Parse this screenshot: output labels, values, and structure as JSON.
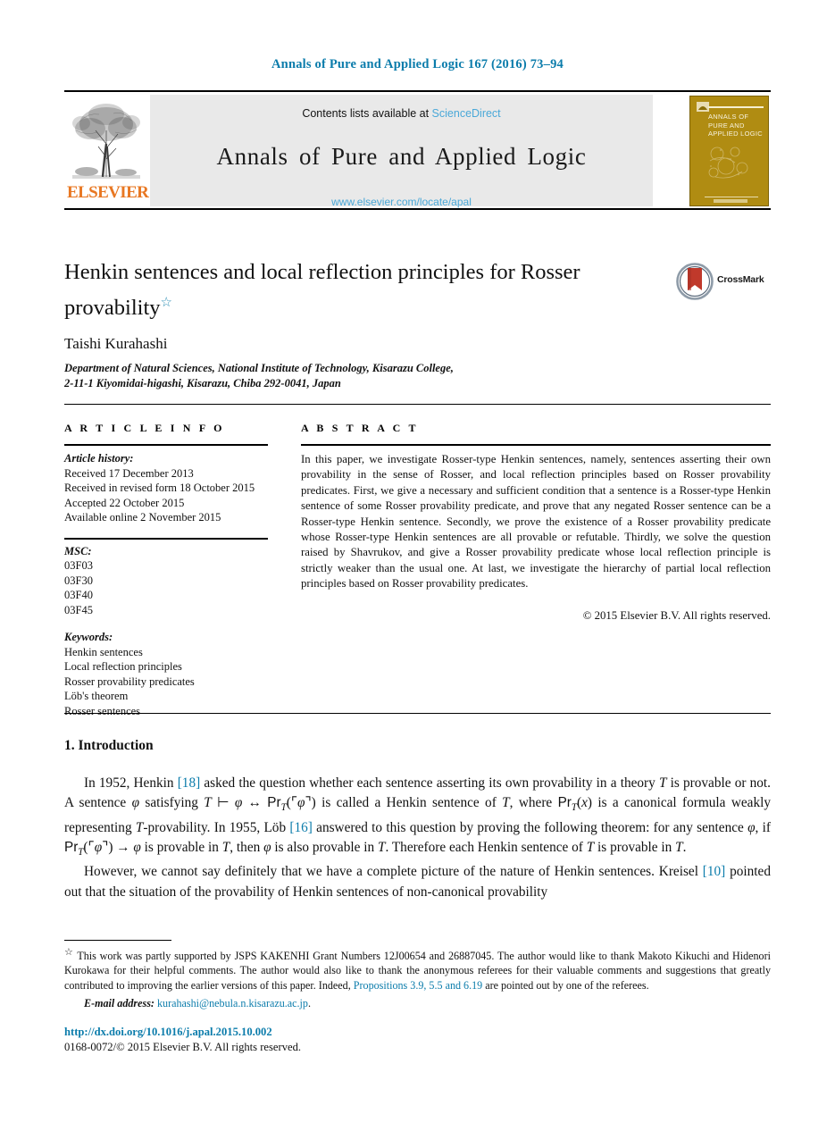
{
  "running_head": "Annals of Pure and Applied Logic 167 (2016) 73–94",
  "masthead": {
    "publisher_wordmark": "ELSEVIER",
    "contents_prefix": "Contents lists available at ",
    "contents_link": "ScienceDirect",
    "journal_name": "Annals of Pure and Applied Logic",
    "journal_url": "www.elsevier.com/locate/apal",
    "cover_title": "ANNALS OF PURE AND APPLIED LOGIC"
  },
  "crossmark": {
    "label": "CrossMark"
  },
  "title": {
    "text": "Henkin sentences and local reflection principles for Rosser provability",
    "footnote_marker": "☆"
  },
  "author": "Taishi Kurahashi",
  "affiliation_line1": "Department of Natural Sciences, National Institute of Technology, Kisarazu College,",
  "affiliation_line2": "2-11-1 Kiyomidai-higashi, Kisarazu, Chiba 292-0041, Japan",
  "info": {
    "heading": "A R T I C L E   I N F O",
    "history_label": "Article history:",
    "history": [
      "Received 17 December 2013",
      "Received in revised form 18 October 2015",
      "Accepted 22 October 2015",
      "Available online 2 November 2015"
    ],
    "msc_label": "MSC:",
    "msc": [
      "03F03",
      "03F30",
      "03F40",
      "03F45"
    ],
    "keywords_label": "Keywords:",
    "keywords": [
      "Henkin sentences",
      "Local reflection principles",
      "Rosser provability predicates",
      "Löb's theorem",
      "Rosser sentences"
    ]
  },
  "abstract": {
    "heading": "A B S T R A C T",
    "text": "In this paper, we investigate Rosser-type Henkin sentences, namely, sentences asserting their own provability in the sense of Rosser, and local reflection principles based on Rosser provability predicates. First, we give a necessary and sufficient condition that a sentence is a Rosser-type Henkin sentence of some Rosser provability predicate, and prove that any negated Rosser sentence can be a Rosser-type Henkin sentence. Secondly, we prove the existence of a Rosser provability predicate whose Rosser-type Henkin sentences are all provable or refutable. Thirdly, we solve the question raised by Shavrukov, and give a Rosser provability predicate whose local reflection principle is strictly weaker than the usual one. At last, we investigate the hierarchy of partial local reflection principles based on Rosser provability predicates.",
    "copyright": "© 2015 Elsevier B.V. All rights reserved."
  },
  "body": {
    "section_title": "1. Introduction",
    "para1_a": "In 1952, Henkin ",
    "para1_ref1": "[18]",
    "para1_b": " asked the question whether each sentence asserting its own provability in a theory ",
    "para1_c": " is provable or not. A sentence ",
    "para1_d": " satisfying ",
    "para1_e": " is called a Henkin sentence of ",
    "para1_f": ", where ",
    "para1_g": " is a canonical formula weakly representing ",
    "para1_h": "-provability. In 1955, Löb ",
    "para1_ref2": "[16]",
    "para1_i": " answered to this question by proving the following theorem: for any sentence ",
    "para1_j": ", if ",
    "para1_k": " is provable in ",
    "para1_l": ", then ",
    "para1_m": " is also provable in ",
    "para1_n": ". Therefore each Henkin sentence of ",
    "para1_o": " is provable in ",
    "para1_p": ".",
    "para2_a": "However, we cannot say definitely that we have a complete picture of the nature of Henkin sentences. Kreisel ",
    "para2_ref": "[10]",
    "para2_b": " pointed out that the situation of the provability of Henkin sentences of non-canonical provability"
  },
  "footnotes": {
    "star": "☆",
    "text_a": "This work was partly supported by JSPS KAKENHI Grant Numbers 12J00654 and 26887045. The author would like to thank Makoto Kikuchi and Hidenori Kurokawa for their helpful comments. The author would also like to thank the anonymous referees for their valuable comments and suggestions that greatly contributed to improving the earlier versions of this paper. Indeed, ",
    "link": "Propositions 3.9, 5.5 and 6.19",
    "text_b": " are pointed out by one of the referees.",
    "email_label": "E-mail address:",
    "email": "kurahashi@nebula.n.kisarazu.ac.jp",
    "email_period": ".",
    "doi": "http://dx.doi.org/10.1016/j.apal.2015.10.002",
    "issn": "0168-0072/© 2015 Elsevier B.V. All rights reserved."
  },
  "colors": {
    "link_blue": "#0b7cab",
    "sciencedirect_blue": "#4aa8d8",
    "elsevier_orange": "#E87722",
    "cover_gold": "#b08c12",
    "crossmark_red": "#c0392b"
  }
}
